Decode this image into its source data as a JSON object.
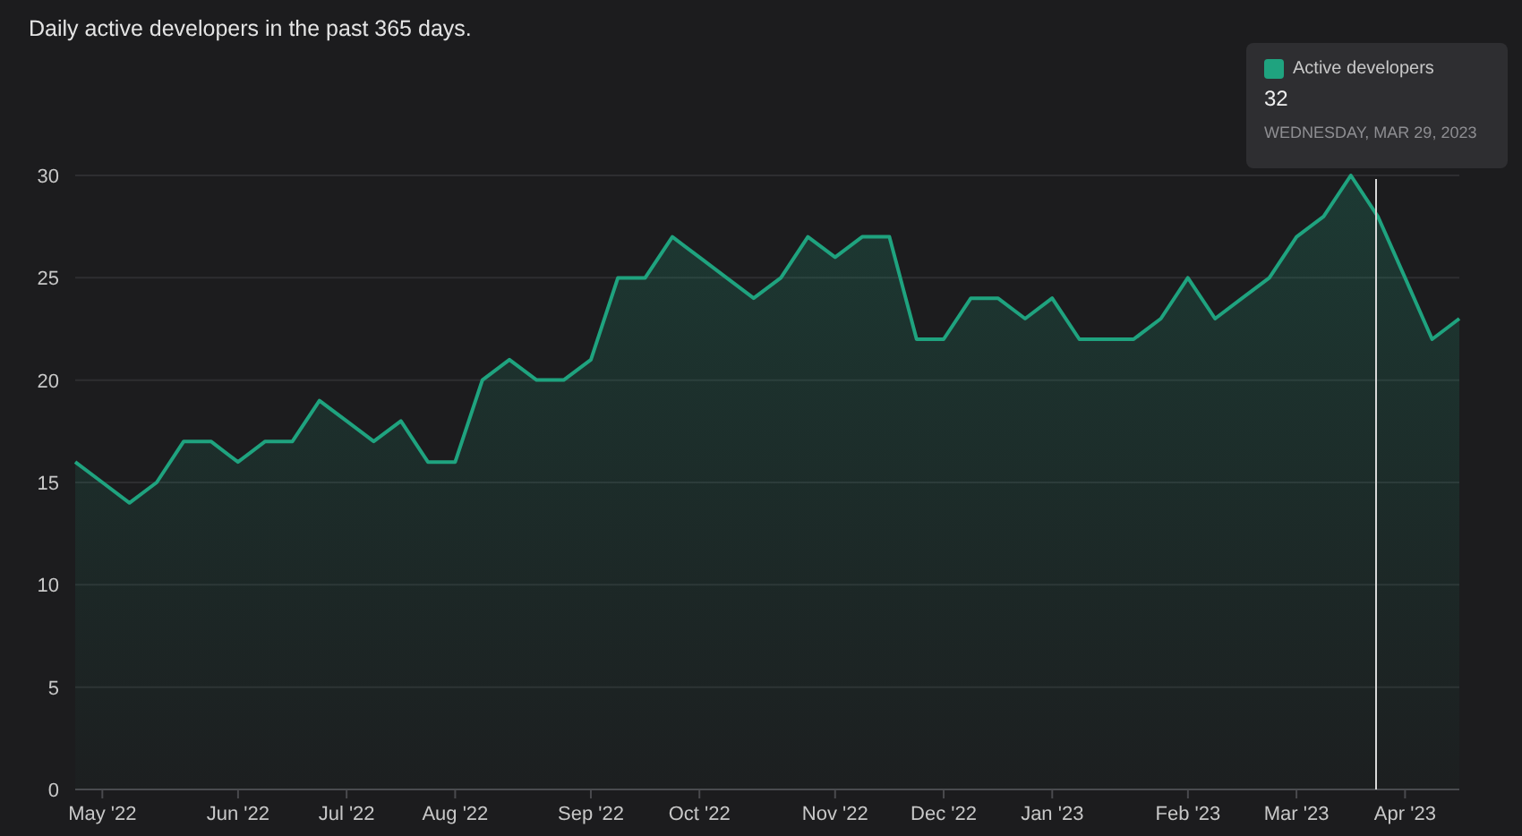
{
  "title": "Daily active developers in the past 365 days.",
  "chart": {
    "chart_data": {
      "type": "area",
      "ylim": [
        0,
        30
      ],
      "yticks": [
        0,
        5,
        10,
        15,
        20,
        25,
        30
      ],
      "categories": [
        null,
        "May '22",
        null,
        null,
        null,
        null,
        "Jun '22",
        null,
        null,
        null,
        "Jul '22",
        null,
        null,
        null,
        "Aug '22",
        null,
        null,
        null,
        null,
        "Sep '22",
        null,
        null,
        null,
        "Oct '22",
        null,
        null,
        null,
        null,
        "Nov '22",
        null,
        null,
        null,
        "Dec '22",
        null,
        null,
        null,
        "Jan '23",
        null,
        null,
        null,
        null,
        "Feb '23",
        null,
        null,
        null,
        "Mar '23",
        null,
        null,
        null,
        "Apr '23",
        null,
        null
      ],
      "series": [
        {
          "name": "Active developers",
          "color": "#1fa37f",
          "values": [
            16,
            15,
            14,
            15,
            17,
            17,
            16,
            17,
            17,
            19,
            18,
            17,
            18,
            16,
            16,
            20,
            21,
            20,
            20,
            21,
            25,
            25,
            27,
            26,
            25,
            24,
            25,
            27,
            26,
            27,
            27,
            22,
            22,
            24,
            24,
            23,
            24,
            22,
            22,
            22,
            23,
            25,
            23,
            24,
            25,
            27,
            28,
            30,
            28,
            25,
            22,
            23
          ]
        }
      ],
      "grid": true
    },
    "tooltip": {
      "value": "32",
      "date": "WEDNESDAY, MAR 29, 2023"
    }
  }
}
